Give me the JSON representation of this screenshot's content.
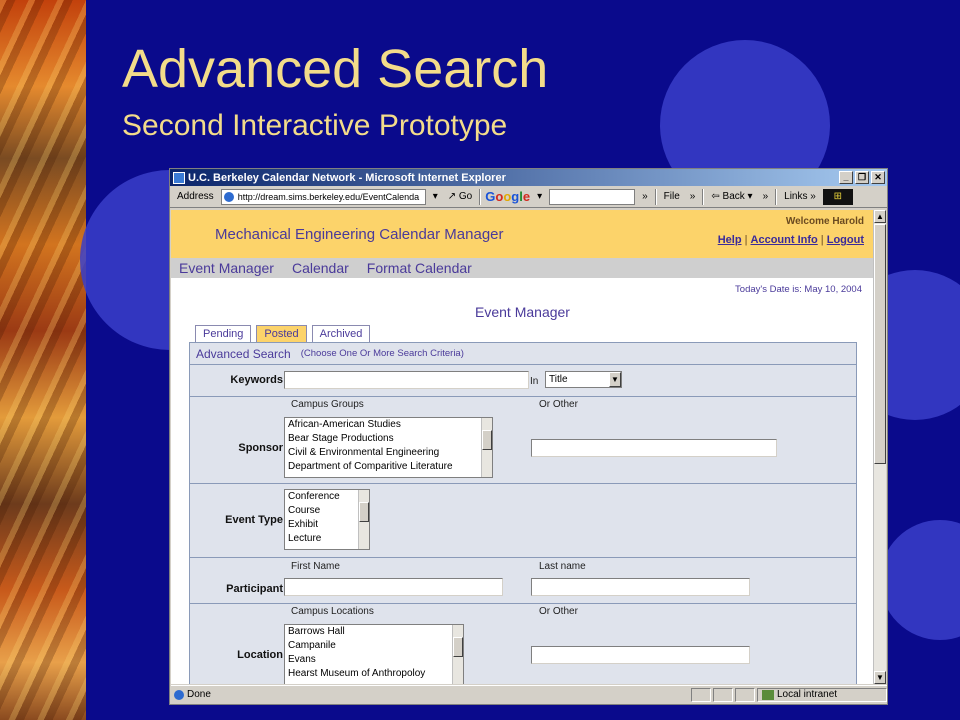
{
  "slide": {
    "title": "Advanced Search",
    "subtitle": "Second Interactive Prototype"
  },
  "browser": {
    "window_title": "U.C. Berkeley Calendar Network - Microsoft Internet Explorer",
    "address_label": "Address",
    "address_value": "http://dream.sims.berkeley.edu/EventCalenda",
    "go_label": "Go",
    "file_label": "File",
    "back_label": "Back",
    "links_label": "Links",
    "google": [
      "G",
      "o",
      "o",
      "g",
      "l",
      "e"
    ],
    "status_text": "Done",
    "status_zone": "Local intranet"
  },
  "app": {
    "title": "Mechanical Engineering Calendar Manager",
    "welcome": "Welcome Harold",
    "links": [
      "Help",
      "Account Info",
      "Logout"
    ],
    "nav": [
      "Event Manager",
      "Calendar",
      "Format Calendar"
    ],
    "date_line": "Today's Date is: May 10, 2004",
    "heading": "Event Manager",
    "tabs": [
      "Pending",
      "Posted",
      "Archived"
    ],
    "active_tab": "Posted"
  },
  "search": {
    "title": "Advanced Search",
    "hint": "(Choose One Or More Search Criteria)",
    "keywords": {
      "label": "Keywords",
      "value": "",
      "in_label": "In",
      "in_selected": "Title"
    },
    "sponsor": {
      "label": "Sponsor",
      "groups_label": "Campus Groups",
      "other_label": "Or Other",
      "options": [
        "African-American Studies",
        "Bear Stage Productions",
        "Civil & Environmental Engineering",
        "Department of Comparitive Literature"
      ],
      "other_value": ""
    },
    "event_type": {
      "label": "Event Type",
      "options": [
        "Conference",
        "Course",
        "Exhibit",
        "Lecture"
      ]
    },
    "participant": {
      "label": "Participant",
      "first_label": "First Name",
      "last_label": "Last name",
      "first_value": "",
      "last_value": ""
    },
    "location": {
      "label": "Location",
      "locations_label": "Campus Locations",
      "other_label": "Or Other",
      "options": [
        "Barrows Hall",
        "Campanile",
        "Evans",
        "Hearst Museum of Anthropoloy"
      ],
      "other_value": ""
    }
  }
}
